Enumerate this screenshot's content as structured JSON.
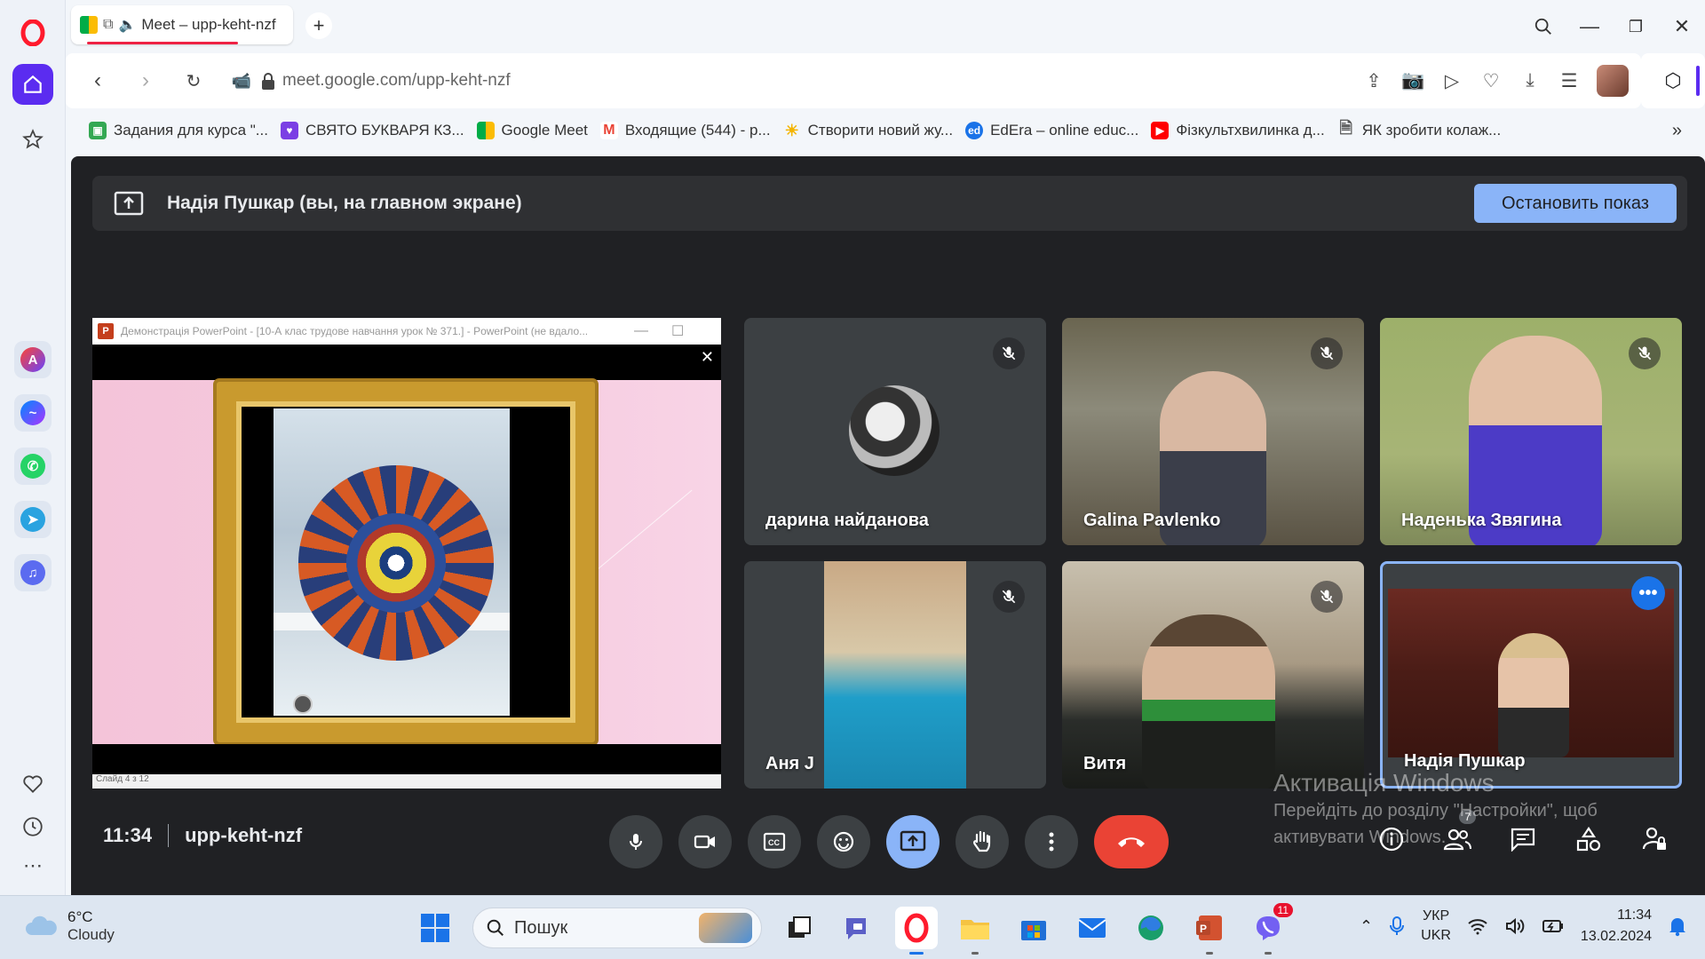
{
  "browser": {
    "tab_title": "Meet – upp-keht-nzf",
    "url": "meet.google.com/upp-keht-nzf",
    "bookmarks": [
      "Задания для курса \"...",
      "СВЯТО БУКВАРЯ КЗ...",
      "Google Meet",
      "Входящие (544) - p...",
      "Створити новий жу...",
      "EdEra – online educ...",
      "Фізкультхвилинка д...",
      "ЯК зробити колаж..."
    ]
  },
  "meet": {
    "banner_text": "Надія Пушкар (вы, на главном экране)",
    "stop_button": "Остановить показ",
    "presentation": {
      "window_title": "Демонстрація PowerPoint - [10-А клас трудове навчання урок № 371.] - PowerPoint (не вдало...",
      "status": "Слайд 4 з 12"
    },
    "participants": [
      {
        "name": "дарина найданова",
        "muted": true
      },
      {
        "name": "Galina Pavlenko",
        "muted": true
      },
      {
        "name": "Наденька Звягина",
        "muted": true
      },
      {
        "name": "Аня J",
        "muted": true
      },
      {
        "name": "Витя",
        "muted": true
      },
      {
        "name": "Надія Пушкар",
        "muted": false
      }
    ],
    "time": "11:34",
    "meeting_code": "upp-keht-nzf",
    "people_count": "7"
  },
  "windows_activation": {
    "title": "Активація Windows",
    "text": "Перейдіть до розділу \"Настройки\", щоб активувати Windows."
  },
  "taskbar": {
    "weather_temp": "6°C",
    "weather_cond": "Cloudy",
    "search_placeholder": "Пошук",
    "lang_top": "УКР",
    "lang_bottom": "UKR",
    "clock_time": "11:34",
    "clock_date": "13.02.2024",
    "viber_badge": "11"
  },
  "colors": {
    "meet_bg": "#202124",
    "accent_blue": "#8ab4f8",
    "end_call_red": "#ea4335",
    "opera_red": "#ff1b2d"
  }
}
